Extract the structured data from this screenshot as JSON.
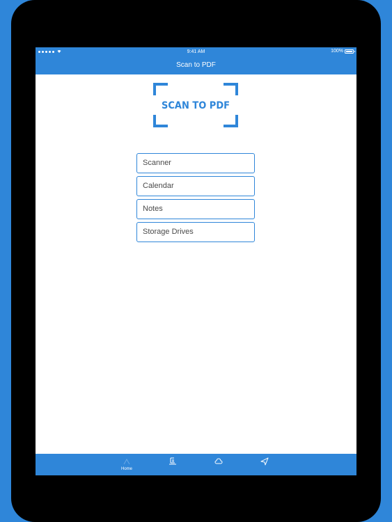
{
  "status_bar": {
    "time": "9:41 AM",
    "battery_percent": "100%",
    "signal_bars": 5
  },
  "nav": {
    "title": "Scan to PDF"
  },
  "logo": {
    "text": "SCAN TO PDF"
  },
  "menu": {
    "items": [
      {
        "label": "Scanner"
      },
      {
        "label": "Calendar"
      },
      {
        "label": "Notes"
      },
      {
        "label": "Storage Drives"
      }
    ]
  },
  "tab_bar": {
    "items": [
      {
        "label": "Home",
        "icon": "home-icon",
        "selected": true
      },
      {
        "label": "",
        "icon": "scanner-icon",
        "selected": false
      },
      {
        "label": "",
        "icon": "cloud-icon",
        "selected": false
      },
      {
        "label": "",
        "icon": "send-icon",
        "selected": false
      }
    ]
  },
  "colors": {
    "accent": "#2f86d9",
    "bezel": "#000000",
    "screen_bg": "#ffffff",
    "text": "#4a4a4a"
  }
}
